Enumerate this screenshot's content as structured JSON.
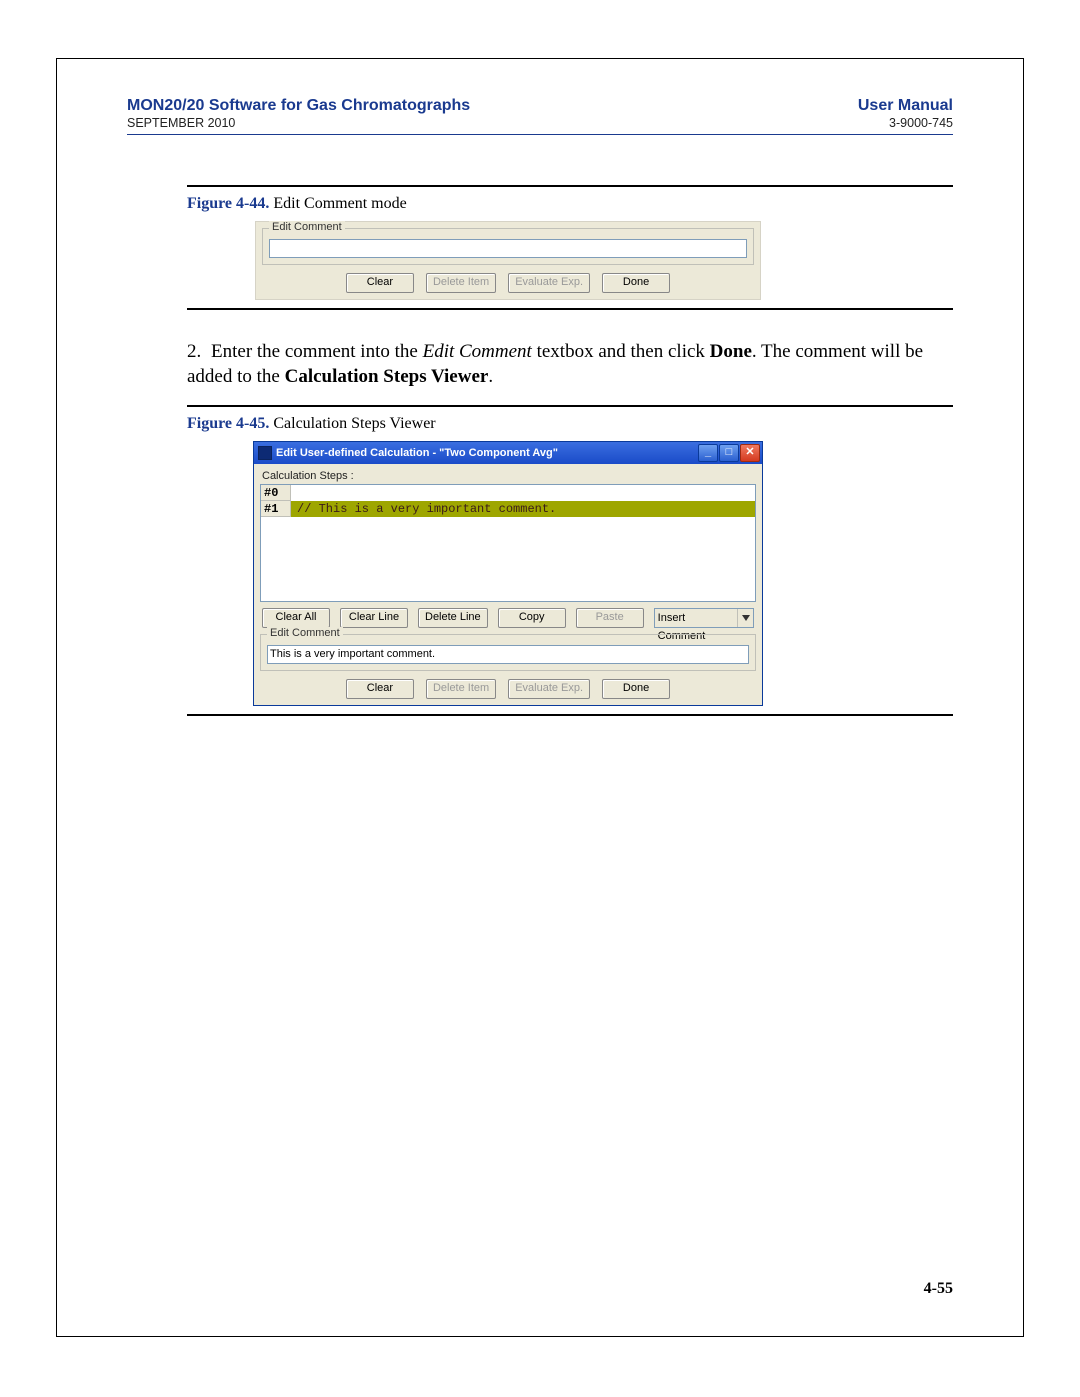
{
  "header": {
    "title_left": "MON20/20 Software for Gas Chromatographs",
    "title_right": "User Manual",
    "sub_left": "SEPTEMBER 2010",
    "sub_right": "3-9000-745"
  },
  "fig44": {
    "caption_label": "Figure 4-44.",
    "caption_text": "Edit Comment mode",
    "group_legend": "Edit Comment",
    "textbox_value": "",
    "buttons": {
      "clear": "Clear",
      "delete_item": "Delete Item",
      "evaluate": "Evaluate Exp.",
      "done": "Done"
    }
  },
  "body": {
    "num": "2.",
    "t1": "Enter the comment into the ",
    "t2": "Edit Comment",
    "t3": " textbox and then click ",
    "t4": "Done",
    "t5": ". The comment will be added to the ",
    "t6": "Calculation Steps Viewer",
    "t7": "."
  },
  "fig45": {
    "caption_label": "Figure 4-45.",
    "caption_text": "Calculation Steps Viewer",
    "titlebar": "Edit User-defined Calculation - \"Two Component Avg\"",
    "calc_steps_label": "Calculation Steps :",
    "steps": [
      {
        "idx": "#0",
        "text": "",
        "hl": false
      },
      {
        "idx": "#1",
        "text": "// This is a very important comment.",
        "hl": true
      }
    ],
    "btns1": {
      "clear_all": "Clear All",
      "clear_line": "Clear Line",
      "delete_line": "Delete Line",
      "copy": "Copy",
      "paste": "Paste"
    },
    "dropdown_value": "Insert Comment",
    "edit_group_legend": "Edit Comment",
    "textbox_value": "This is a very important comment.",
    "btns2": {
      "clear": "Clear",
      "delete_item": "Delete Item",
      "evaluate": "Evaluate Exp.",
      "done": "Done"
    }
  },
  "page_number": "4-55",
  "titlebar_ctrls": {
    "min": "_",
    "max": "□",
    "close": "✕"
  }
}
